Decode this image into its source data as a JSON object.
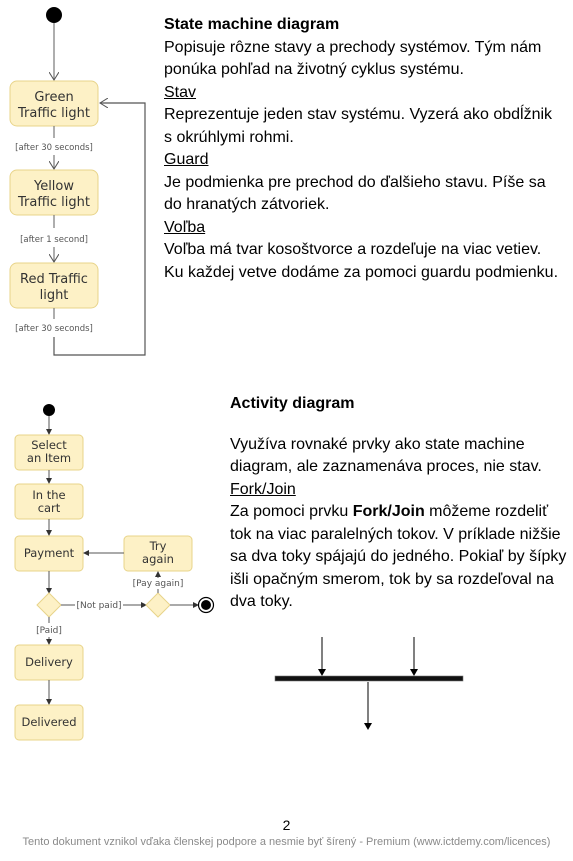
{
  "state_section": {
    "title": "State machine diagram",
    "intro": "Popisuje rôzne stavy a prechody systémov. Tým nám ponúka pohľad na životný cyklus systému.",
    "terms": [
      {
        "term": "Stav",
        "description": "Reprezentuje jeden stav systému. Vyzerá ako obdĺžnik s okrúhlymi rohmi."
      },
      {
        "term": "Guard",
        "description": "Je podmienka pre prechod do ďalšieho stavu. Píše sa do hranatých zátvoriek."
      },
      {
        "term": "Voľba",
        "description": "Voľba má tvar kosoštvorce a rozdeľuje na viac vetiev. Ku každej vetve dodáme za pomoci guardu podmienku."
      }
    ]
  },
  "state_diagram": {
    "states": [
      {
        "line1": "Green",
        "line2": "Traffic light"
      },
      {
        "line1": "Yellow",
        "line2": "Traffic light"
      },
      {
        "line1": "Red Traffic",
        "line2": "light"
      }
    ],
    "guards": [
      "[after 30 seconds]",
      "[after 1 second]",
      "[after 30 seconds]"
    ],
    "colors": {
      "state_fill": "#fdf1c6",
      "state_stroke": "#e8d48a",
      "line": "#555555"
    }
  },
  "activity_section": {
    "title": "Activity diagram",
    "intro": "Využíva rovnaké prvky ako state machine diagram, ale zaznamenáva proces, nie stav.",
    "term": "Fork/Join",
    "desc_prefix": "Za pomoci prvku ",
    "desc_bold": "Fork/Join",
    "desc_suffix": " môžeme rozdeliť tok na viac paralelných tokov. V príklade nižšie sa dva toky spájajú do jedného. Pokiaľ by šípky išli opačným smerom, tok by sa rozdeľoval na dva toky."
  },
  "activity_diagram": {
    "actions": [
      {
        "line1": "Select",
        "line2": "an Item"
      },
      {
        "line1": "In the",
        "line2": "cart"
      },
      {
        "line1": "Payment",
        "line2": ""
      },
      {
        "line1": "Try",
        "line2": "again"
      },
      {
        "line1": "Delivery",
        "line2": ""
      },
      {
        "line1": "Delivered",
        "line2": ""
      }
    ],
    "guards": {
      "not_paid": "[Not paid]",
      "paid": "[Paid]",
      "pay_again": "[Pay again]"
    }
  },
  "footer": {
    "page_number": "2",
    "notice": "Tento dokument vznikol vďaka členskej podpore a nesmie byť šírený - Premium (www.ictdemy.com/licences)"
  }
}
